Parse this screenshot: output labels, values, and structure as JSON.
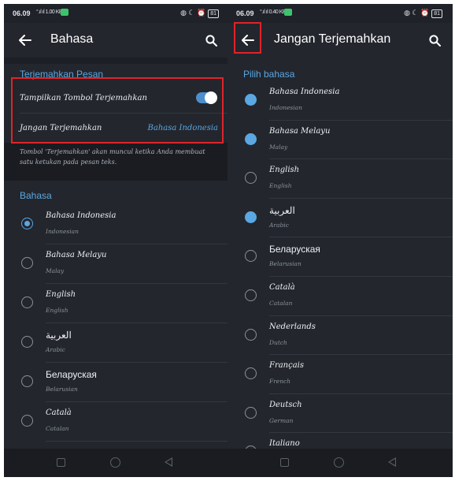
{
  "left_screen": {
    "status": {
      "time": "06.09",
      "network": "°.ıl ıl 1.00 KB/S",
      "system_icons": "◍ ☾ ⏰",
      "battery": "81"
    },
    "title": "Bahasa",
    "section_translate": "Terjemahkan Pesan",
    "toggle_label": "Tampilkan Tombol Terjemahkan",
    "toggle_on": true,
    "dont_translate_label": "Jangan Terjemahkan",
    "dont_translate_value": "Bahasa Indonesia",
    "info_text": "Tombol 'Terjemahkan' akan muncul ketika Anda membuat satu ketukan pada pesan teks.",
    "section_language": "Bahasa",
    "languages": [
      {
        "name": "Bahasa Indonesia",
        "sub": "Indonesian",
        "selected": true
      },
      {
        "name": "Bahasa Melayu",
        "sub": "Malay",
        "selected": false
      },
      {
        "name": "English",
        "sub": "English",
        "selected": false
      },
      {
        "name": "العربية",
        "sub": "Arabic",
        "selected": false
      },
      {
        "name": "Беларуская",
        "sub": "Belarusian",
        "selected": false
      },
      {
        "name": "Català",
        "sub": "Catalan",
        "selected": false
      }
    ]
  },
  "right_screen": {
    "status": {
      "time": "06.09",
      "network": "°.ıl ıl 0.40 KB/S",
      "system_icons": "◍ ☾ ⏰",
      "battery": "81"
    },
    "title": "Jangan Terjemahkan",
    "section_choose": "Pilih bahasa",
    "languages": [
      {
        "name": "Bahasa Indonesia",
        "sub": "Indonesian",
        "checked": true
      },
      {
        "name": "Bahasa Melayu",
        "sub": "Malay",
        "checked": true
      },
      {
        "name": "English",
        "sub": "English",
        "checked": false
      },
      {
        "name": "العربية",
        "sub": "Arabic",
        "checked": true
      },
      {
        "name": "Беларуская",
        "sub": "Belarusian",
        "checked": false
      },
      {
        "name": "Català",
        "sub": "Catalan",
        "checked": false
      },
      {
        "name": "Nederlands",
        "sub": "Dutch",
        "checked": false
      },
      {
        "name": "Français",
        "sub": "French",
        "checked": false
      },
      {
        "name": "Deutsch",
        "sub": "German",
        "checked": false
      },
      {
        "name": "Italiano",
        "sub": "",
        "checked": false
      }
    ]
  },
  "colors": {
    "accent": "#5aa7e2",
    "background": "#1d1f26",
    "highlight": "#e0232a"
  },
  "icons": [
    "arrow-left-icon",
    "search-icon",
    "whatsapp-notification-icon",
    "battery-icon",
    "nav-recents-icon",
    "nav-home-icon",
    "nav-back-icon"
  ]
}
